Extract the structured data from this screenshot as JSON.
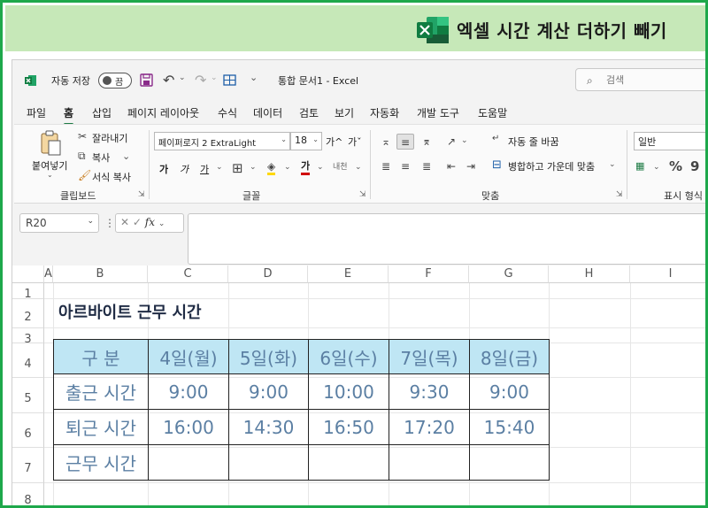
{
  "banner": {
    "title": "엑셀 시간 계산 더하기 빼기"
  },
  "titlebar": {
    "autosave_label": "자동 저장",
    "autosave_state": "끔",
    "document_title": "통합 문서1  -  Excel",
    "search_placeholder": "검색"
  },
  "tabs": [
    "파일",
    "홈",
    "삽입",
    "페이지 레이아웃",
    "수식",
    "데이터",
    "검토",
    "보기",
    "자동화",
    "개발 도구",
    "도움말"
  ],
  "active_tab": "홈",
  "ribbon": {
    "clipboard": {
      "paste": "붙여넣기",
      "cut": "잘라내기",
      "copy": "복사",
      "format_painter": "서식 복사",
      "group": "클립보드"
    },
    "font": {
      "name": "페이퍼로지 2 ExtraLight",
      "size": "18",
      "grow": "가^",
      "shrink": "가ˇ",
      "bold": "가",
      "italic": "가",
      "underline": "가",
      "group": "글꼴"
    },
    "alignment": {
      "wrap": "자동 줄 바꿈",
      "merge": "병합하고 가운데 맞춤",
      "group": "맞춤"
    },
    "number": {
      "format": "일반",
      "group": "표시 형식"
    }
  },
  "formula_bar": {
    "name_box": "R20",
    "formula": ""
  },
  "columns": [
    "A",
    "B",
    "C",
    "D",
    "E",
    "F",
    "G",
    "H",
    "I"
  ],
  "rows": [
    "1",
    "2",
    "3",
    "4",
    "5",
    "6",
    "7",
    "8"
  ],
  "sheet": {
    "title": "아르바이트 근무 시간",
    "header": [
      "구    분",
      "4일(월)",
      "5일(화)",
      "6일(수)",
      "7일(목)",
      "8일(금)"
    ],
    "body": [
      [
        "출근 시간",
        "9:00",
        "9:00",
        "10:00",
        "9:30",
        "9:00"
      ],
      [
        "퇴근 시간",
        "16:00",
        "14:30",
        "16:50",
        "17:20",
        "15:40"
      ],
      [
        "근무 시간",
        "",
        "",
        "",
        "",
        ""
      ]
    ]
  },
  "colors": {
    "banner_bg": "#c6e8b8",
    "frame": "#1ea84b",
    "header_fill": "#bfe6f4",
    "value_text": "#5b7fa3",
    "excel_green": "#1e7b45"
  }
}
